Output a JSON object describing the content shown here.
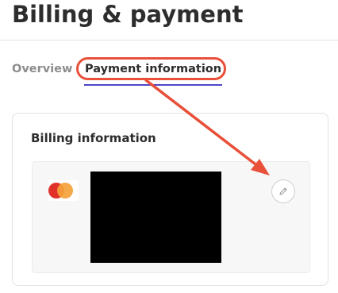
{
  "page": {
    "title": "Billing & payment"
  },
  "tabs": [
    {
      "label": "Overview",
      "active": false
    },
    {
      "label": "Payment information",
      "active": true
    }
  ],
  "billing": {
    "section_title": "Billing information",
    "card_brand": "mastercard-icon",
    "card_details": "",
    "edit_icon": "pencil-icon"
  },
  "colors": {
    "accent": "#4d47c7",
    "annotation": "#e8503a",
    "mastercard_red": "#e0312a",
    "mastercard_orange": "#f5a23a"
  }
}
